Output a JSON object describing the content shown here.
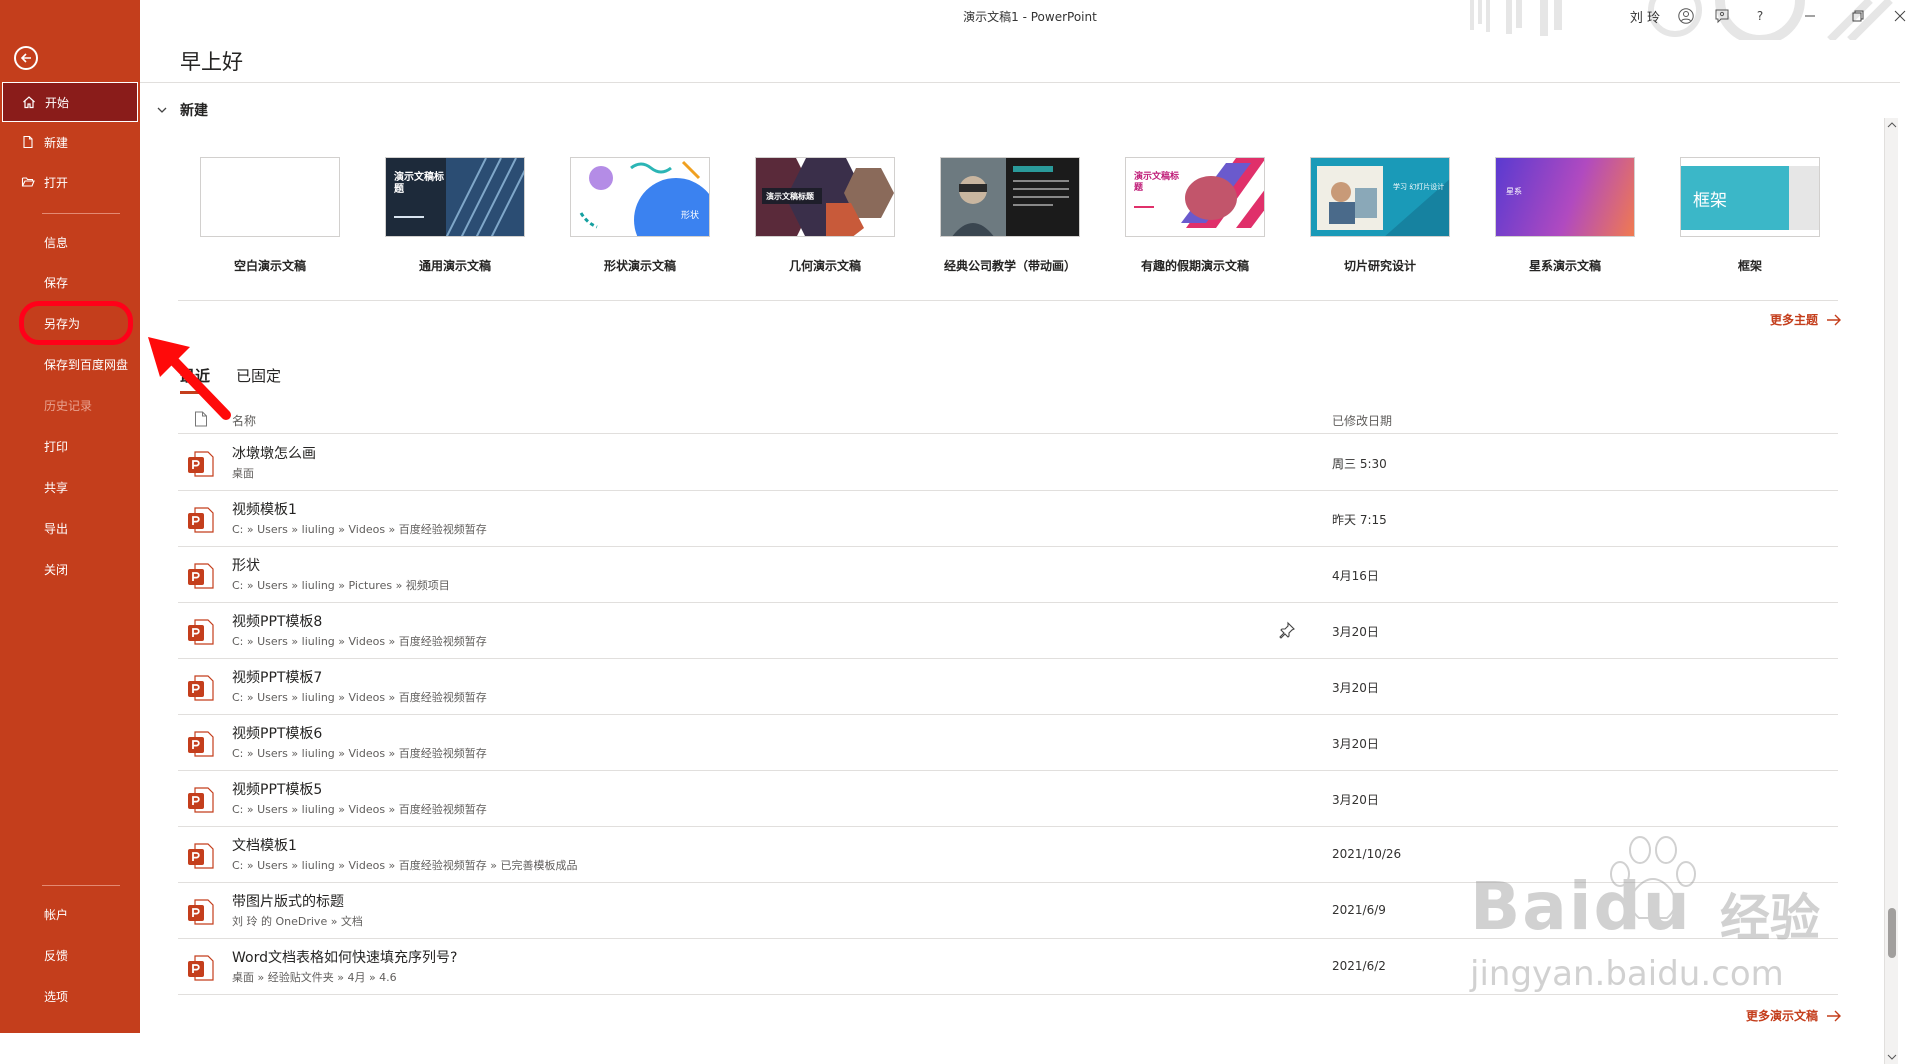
{
  "window": {
    "title": "演示文稿1  -  PowerPoint",
    "user": "刘 玲"
  },
  "sidebar": {
    "items": [
      {
        "label": "开始",
        "icon": "home-icon"
      },
      {
        "label": "新建",
        "icon": "new-document-icon"
      },
      {
        "label": "打开",
        "icon": "folder-open-icon"
      },
      {
        "label": "信息"
      },
      {
        "label": "保存"
      },
      {
        "label": "另存为"
      },
      {
        "label": "保存到百度网盘"
      },
      {
        "label": "历史记录"
      },
      {
        "label": "打印"
      },
      {
        "label": "共享"
      },
      {
        "label": "导出"
      },
      {
        "label": "关闭"
      },
      {
        "label": "帐户"
      },
      {
        "label": "反馈"
      },
      {
        "label": "选项"
      }
    ]
  },
  "main": {
    "greeting": "早上好",
    "new_section": "新建",
    "templates": [
      {
        "name": "空白演示文稿",
        "thumb_text": ""
      },
      {
        "name": "通用演示文稿",
        "thumb_text": "演示文稿标题"
      },
      {
        "name": "形状演示文稿",
        "thumb_text": "形状"
      },
      {
        "name": "几何演示文稿",
        "thumb_text": "演示文稿标题"
      },
      {
        "name": "经典公司教学（带动画）",
        "thumb_text": ""
      },
      {
        "name": "有趣的假期演示文稿",
        "thumb_text": "演示文稿标题"
      },
      {
        "name": "切片研究设计",
        "thumb_text": "学习 幻灯片设计"
      },
      {
        "name": "星系演示文稿",
        "thumb_text": "星系"
      },
      {
        "name": "框架",
        "thumb_text": "框架"
      }
    ],
    "more_themes": "更多主题",
    "tabs": [
      {
        "label": "最近"
      },
      {
        "label": "已固定"
      }
    ],
    "columns": {
      "name": "名称",
      "date": "已修改日期"
    },
    "files": [
      {
        "name": "冰墩墩怎么画",
        "path": "桌面",
        "date": "周三 5:30"
      },
      {
        "name": "视频模板1",
        "path": "C: » Users » liuling » Videos » 百度经验视频暂存",
        "date": "昨天 7:15"
      },
      {
        "name": "形状",
        "path": "C: » Users » liuling » Pictures » 视频项目",
        "date": "4月16日"
      },
      {
        "name": "视频PPT模板8",
        "path": "C: » Users » liuling » Videos » 百度经验视频暂存",
        "date": "3月20日"
      },
      {
        "name": "视频PPT模板7",
        "path": "C: » Users » liuling » Videos » 百度经验视频暂存",
        "date": "3月20日"
      },
      {
        "name": "视频PPT模板6",
        "path": "C: » Users » liuling » Videos » 百度经验视频暂存",
        "date": "3月20日"
      },
      {
        "name": "视频PPT模板5",
        "path": "C: » Users » liuling » Videos » 百度经验视频暂存",
        "date": "3月20日"
      },
      {
        "name": "文档模板1",
        "path": "C: » Users » liuling » Videos » 百度经验视频暂存 » 已完善模板成品",
        "date": "2021/10/26"
      },
      {
        "name": "带图片版式的标题",
        "path": "刘 玲 的 OneDrive » 文档",
        "date": "2021/6/9"
      },
      {
        "name": "Word文档表格如何快速填充序列号?",
        "path": "桌面 » 经验贴文件夹 » 4月 » 4.6",
        "date": "2021/6/2"
      }
    ],
    "more_files": "更多演示文稿"
  },
  "watermark": {
    "brand": "Baidu",
    "cn": "经验",
    "url": "jingyan.baidu.com"
  },
  "colors": {
    "accent": "#c43e1c",
    "active_nav": "#8a1c1a",
    "highlight": "#ff0019"
  }
}
